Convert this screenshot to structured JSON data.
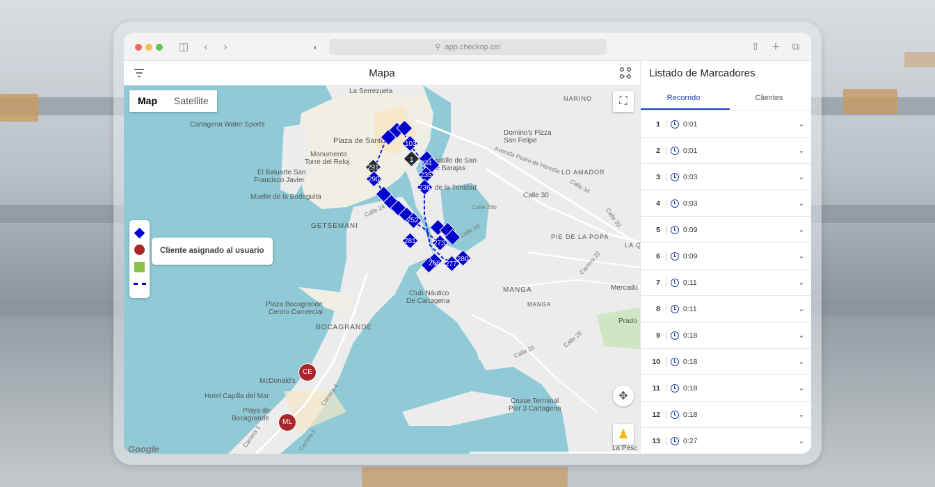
{
  "browser": {
    "url": "app.checkop.co/",
    "colors": {
      "close": "#ec6a5e",
      "minimize": "#f4bf4f",
      "maximize": "#61c554"
    }
  },
  "map_panel": {
    "title": "Mapa",
    "map_type": {
      "map_label": "Map",
      "satellite_label": "Satellite"
    },
    "legend_tooltip": "Cliente asignado al usuario",
    "google_logo": "Google",
    "labels": {
      "serrezuela": "La Serrezuela",
      "narino": "NARINO",
      "water_sports": "Cartagena Water Sports",
      "plaza_santo": "Plaza de Santo",
      "dominos": "Domino's Pizza",
      "san_felipe": "San Felipe",
      "monumento": "Monumento",
      "torre_reloj": "Torre del Reloj",
      "castillo": "astillo de San",
      "barajas": "de Barajas",
      "avenida": "Avenida Pedro de Heredia",
      "lo_amador": "LO AMADOR",
      "baluarte": "El Baluarte San",
      "francisco": "Francisco Javier",
      "trinidad": "de la Trinidad",
      "calle34": "Calle 34",
      "calle30": "Calle 30",
      "calle29b": "Calle 29b",
      "muelle": "Muelle de la Bodeguita",
      "calle24": "Calle 24",
      "calle29": "Calle 29",
      "pie_popa": "PIE DE LA POPA",
      "la_qu": "LA QU",
      "getsemani": "GETSEMANI",
      "manga": "MANGA",
      "manga_small": "MANGA",
      "mercado": "Mercado",
      "club_nautico": "Club Náutico",
      "de_cartagena": "De Cartagena",
      "plaza_bocagrande": "Plaza Bocagrande",
      "centro_comercial": "Centro Comercial",
      "bocagrande": "BOCAGRANDE",
      "prado": "Prado",
      "mcdonalds": "McDonald's",
      "capilla": "Hotel Capilla del Mar",
      "playa": "Playa de",
      "bocagrande_beach": "Bocagrande",
      "cruise": "Cruise Terminal",
      "pier3": "Pier 3 Cartagena",
      "la_pesc": "La Pesc",
      "calle28": "Calle 28",
      "calle26": "Calle 26",
      "carrera4": "Carrera 4",
      "carrera1": "Carrera 1",
      "carrera5": "Carrera 5",
      "calle33": "Calle 33",
      "carrera22": "Carrera 22"
    },
    "markers": [
      "1",
      "291",
      "290",
      "103",
      "234",
      "235",
      "236",
      "252",
      "281",
      "273",
      "266",
      "277",
      "280"
    ],
    "client_markers": [
      "CE",
      "ML"
    ],
    "colors": {
      "route_marker": "#0000cc",
      "start_marker": "#222b33",
      "client": "#a8272b",
      "area": "#8bc34a",
      "water": "#8fcad6"
    }
  },
  "side_panel": {
    "title": "Listado de Marcadores",
    "tabs": [
      {
        "label": "Recorrido",
        "active": true
      },
      {
        "label": "Clientes",
        "active": false
      }
    ],
    "rows": [
      {
        "num": "1",
        "time": "0:01"
      },
      {
        "num": "2",
        "time": "0:01"
      },
      {
        "num": "3",
        "time": "0:03"
      },
      {
        "num": "4",
        "time": "0:03"
      },
      {
        "num": "5",
        "time": "0:09"
      },
      {
        "num": "6",
        "time": "0:09"
      },
      {
        "num": "7",
        "time": "0:11"
      },
      {
        "num": "8",
        "time": "0:11"
      },
      {
        "num": "9",
        "time": "0:18"
      },
      {
        "num": "10",
        "time": "0:18"
      },
      {
        "num": "11",
        "time": "0:18"
      },
      {
        "num": "12",
        "time": "0:18"
      },
      {
        "num": "13",
        "time": "0:27"
      }
    ],
    "accent": "#1d3fb3"
  }
}
